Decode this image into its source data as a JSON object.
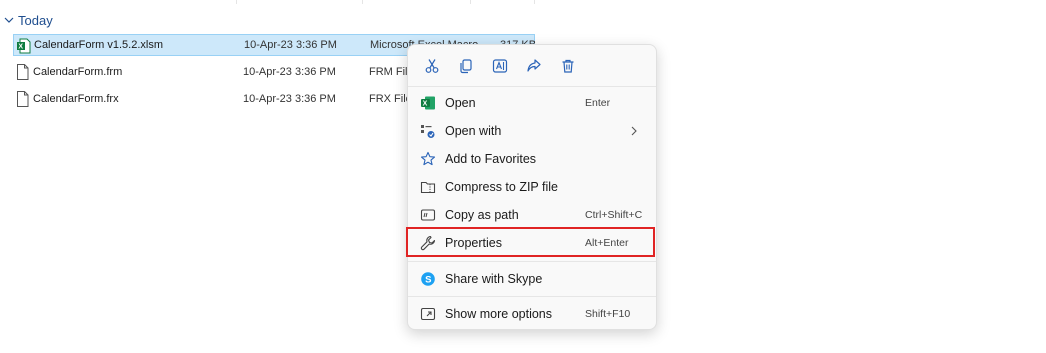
{
  "group": {
    "label": "Today"
  },
  "files": [
    {
      "name": "CalendarForm v1.5.2.xlsm",
      "date": "10-Apr-23 3:36 PM",
      "type": "Microsoft Excel Macro...",
      "size": "317 KB",
      "icon": "excel-file-icon"
    },
    {
      "name": "CalendarForm.frm",
      "date": "10-Apr-23 3:36 PM",
      "type": "FRM File",
      "icon": "document-file-icon"
    },
    {
      "name": "CalendarForm.frx",
      "date": "10-Apr-23 3:36 PM",
      "type": "FRX File",
      "icon": "document-file-icon"
    }
  ],
  "toolbar": [
    "cut-icon",
    "copy-icon",
    "rename-icon",
    "share-icon",
    "delete-icon"
  ],
  "menu": [
    {
      "label": "Open",
      "shortcut": "Enter",
      "icon": "excel-icon"
    },
    {
      "label": "Open with",
      "shortcut": "",
      "icon": "open-with-icon",
      "submenu": true
    },
    {
      "label": "Add to Favorites",
      "shortcut": "",
      "icon": "star-icon"
    },
    {
      "label": "Compress to ZIP file",
      "shortcut": "",
      "icon": "zip-folder-icon"
    },
    {
      "label": "Copy as path",
      "shortcut": "Ctrl+Shift+C",
      "icon": "copy-path-icon"
    },
    {
      "label": "Properties",
      "shortcut": "Alt+Enter",
      "icon": "wrench-icon",
      "highlighted": true
    },
    {
      "label": "Share with Skype",
      "shortcut": "",
      "icon": "skype-icon"
    },
    {
      "label": "Show more options",
      "shortcut": "Shift+F10",
      "icon": "more-options-icon"
    }
  ],
  "colors": {
    "accent": "#1f4e8f",
    "selection": "#cde8fa",
    "highlight_border": "#e02424",
    "excel_green": "#107c41",
    "icon_blue": "#2b64b8",
    "skype_blue": "#1da1f2"
  }
}
